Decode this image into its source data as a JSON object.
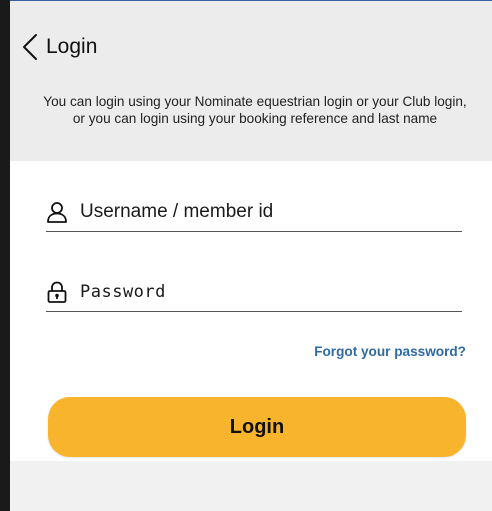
{
  "header": {
    "title": "Login",
    "back_icon": "chevron-left-icon",
    "info_text": "You can login using your Nominate equestrian login or your Club login, or you can login using your booking reference and last name"
  },
  "form": {
    "username": {
      "placeholder": "Username / member id",
      "value": "",
      "icon": "user-icon"
    },
    "password": {
      "placeholder": "Password",
      "value": "",
      "icon": "lock-icon"
    },
    "forgot_label": "Forgot your password?",
    "login_label": "Login"
  },
  "colors": {
    "header_bg": "#ececec",
    "accent": "#f9b42e",
    "link": "#2e6ba6",
    "footer_bg": "#f1f1f1"
  }
}
